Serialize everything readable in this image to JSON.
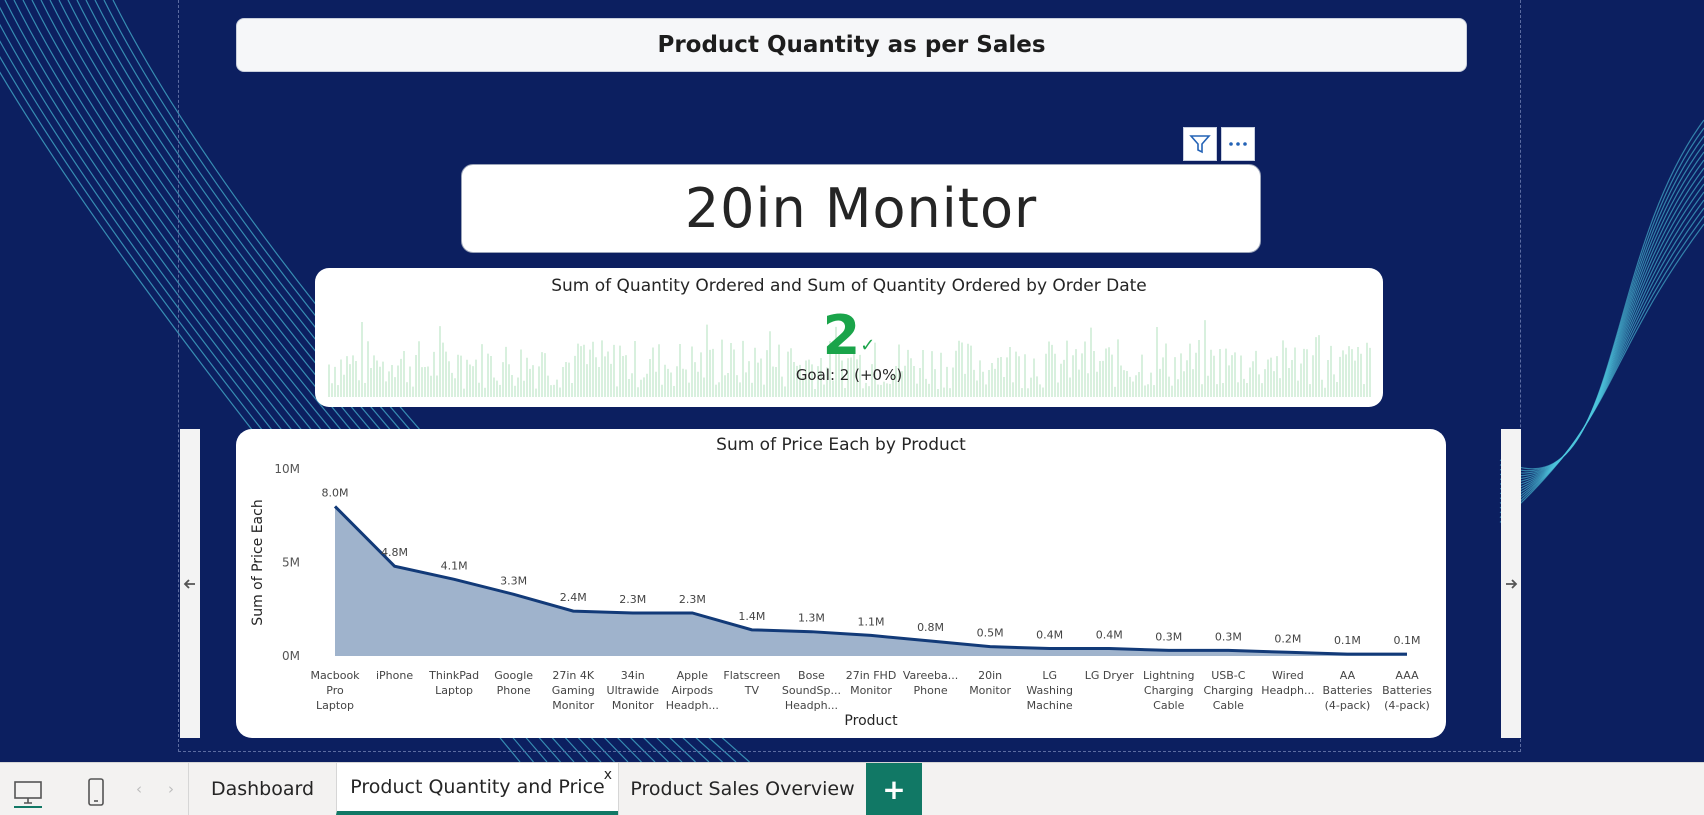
{
  "header": {
    "title": "Product Quantity as per Sales"
  },
  "slicer": {
    "selected_product": "20in Monitor",
    "filter_icon": "filter-icon",
    "more_icon": "more-options-icon"
  },
  "kpi": {
    "title": "Sum of Quantity Ordered and Sum of Quantity Ordered by Order Date",
    "value": "2",
    "check": "✓",
    "goal": "Goal: 2 (+0%)"
  },
  "chart_data": {
    "type": "area",
    "title": "Sum of Price Each by Product",
    "xlabel": "Product",
    "ylabel": "Sum of Price Each",
    "ylim": [
      0,
      10000000
    ],
    "yticks": [
      "10M",
      "5M",
      "0M"
    ],
    "categories": [
      [
        "Macbook",
        "Pro",
        "Laptop"
      ],
      [
        "iPhone"
      ],
      [
        "ThinkPad",
        "Laptop"
      ],
      [
        "Google",
        "Phone"
      ],
      [
        "27in 4K",
        "Gaming",
        "Monitor"
      ],
      [
        "34in",
        "Ultrawide",
        "Monitor"
      ],
      [
        "Apple",
        "Airpods",
        "Headph..."
      ],
      [
        "Flatscreen",
        "TV"
      ],
      [
        "Bose",
        "SoundSp...",
        "Headph..."
      ],
      [
        "27in FHD",
        "Monitor"
      ],
      [
        "Vareeba...",
        "Phone"
      ],
      [
        "20in",
        "Monitor"
      ],
      [
        "LG",
        "Washing",
        "Machine"
      ],
      [
        "LG Dryer"
      ],
      [
        "Lightning",
        "Charging",
        "Cable"
      ],
      [
        "USB-C",
        "Charging",
        "Cable"
      ],
      [
        "Wired",
        "Headph..."
      ],
      [
        "AA",
        "Batteries",
        "(4-pack)"
      ],
      [
        "AAA",
        "Batteries",
        "(4-pack)"
      ]
    ],
    "values": [
      8.0,
      4.8,
      4.1,
      3.3,
      2.4,
      2.3,
      2.3,
      1.4,
      1.3,
      1.1,
      0.8,
      0.5,
      0.4,
      0.4,
      0.3,
      0.3,
      0.2,
      0.1,
      0.1
    ],
    "labels": [
      "8.0M",
      "4.8M",
      "4.1M",
      "3.3M",
      "2.4M",
      "2.3M",
      "2.3M",
      "1.4M",
      "1.3M",
      "1.1M",
      "0.8M",
      "0.5M",
      "0.4M",
      "0.4M",
      "0.3M",
      "0.3M",
      "0.2M",
      "0.1M",
      "0.1M"
    ],
    "unit": "M",
    "colors": {
      "line": "#123a78",
      "fill": "#9fb3cc"
    }
  },
  "tabs": [
    {
      "label": "Dashboard",
      "active": false
    },
    {
      "label": "Product Quantity and Price",
      "active": true,
      "close": "x"
    },
    {
      "label": "Product Sales Overview",
      "active": false
    }
  ],
  "tabbar": {
    "add_label": "+",
    "prev": "‹",
    "next": "›"
  },
  "colors": {
    "background": "#0c1f60",
    "kpi_green": "#1aa44a",
    "tab_accent": "#117865"
  }
}
